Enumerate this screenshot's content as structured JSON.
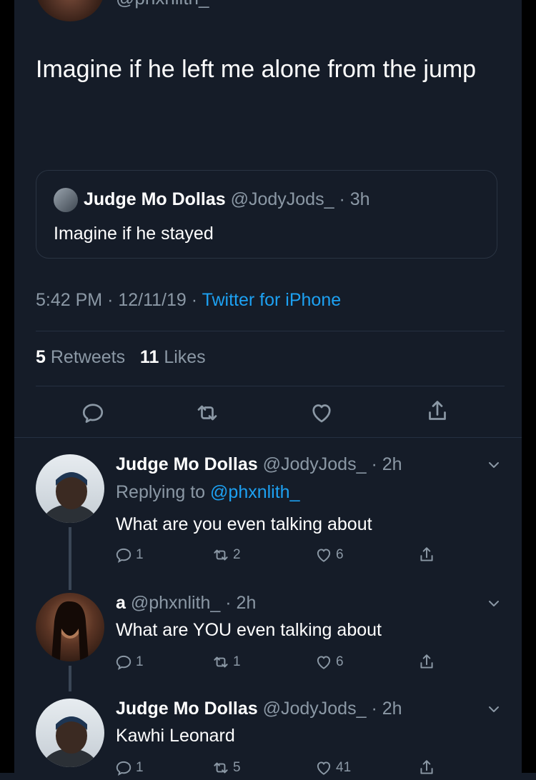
{
  "top_tweet": {
    "handle_partial": "@phxnlith_",
    "text": "Imagine if he left me alone from the jump",
    "quoted": {
      "name": "Judge Mo Dollas",
      "handle": "@JodyJods_",
      "sep": "·",
      "time": "3h",
      "text": "Imagine if he stayed"
    },
    "meta": {
      "time": "5:42 PM",
      "sep1": "·",
      "date": "12/11/19",
      "sep2": "·",
      "source": "Twitter for iPhone"
    },
    "stats": {
      "retweets_count": "5",
      "retweets_label": "Retweets",
      "likes_count": "11",
      "likes_label": "Likes"
    }
  },
  "replies": [
    {
      "name": "Judge Mo Dollas",
      "handle": "@JodyJods_",
      "sep": "·",
      "time": "2h",
      "replying_label": "Replying to",
      "replying_to": "@phxnlith_",
      "text": "What are you even talking about",
      "reply_count": "1",
      "retweet_count": "2",
      "like_count": "6"
    },
    {
      "name": "a",
      "handle": "@phxnlith_",
      "sep": "·",
      "time": "2h",
      "text": "What are YOU even talking about",
      "reply_count": "1",
      "retweet_count": "1",
      "like_count": "6"
    },
    {
      "name": "Judge Mo Dollas",
      "handle": "@JodyJods_",
      "sep": "·",
      "time": "2h",
      "text": "Kawhi Leonard",
      "reply_count": "1",
      "retweet_count": "5",
      "like_count": "41"
    }
  ],
  "icons": {
    "reply": "reply-icon",
    "retweet": "retweet-icon",
    "like": "heart-icon",
    "share": "share-icon",
    "more": "chevron-down-icon"
  },
  "colors": {
    "background": "#151c28",
    "text": "#ffffff",
    "secondary": "#8b98a5",
    "link": "#1da1f2",
    "divider": "#253041"
  }
}
